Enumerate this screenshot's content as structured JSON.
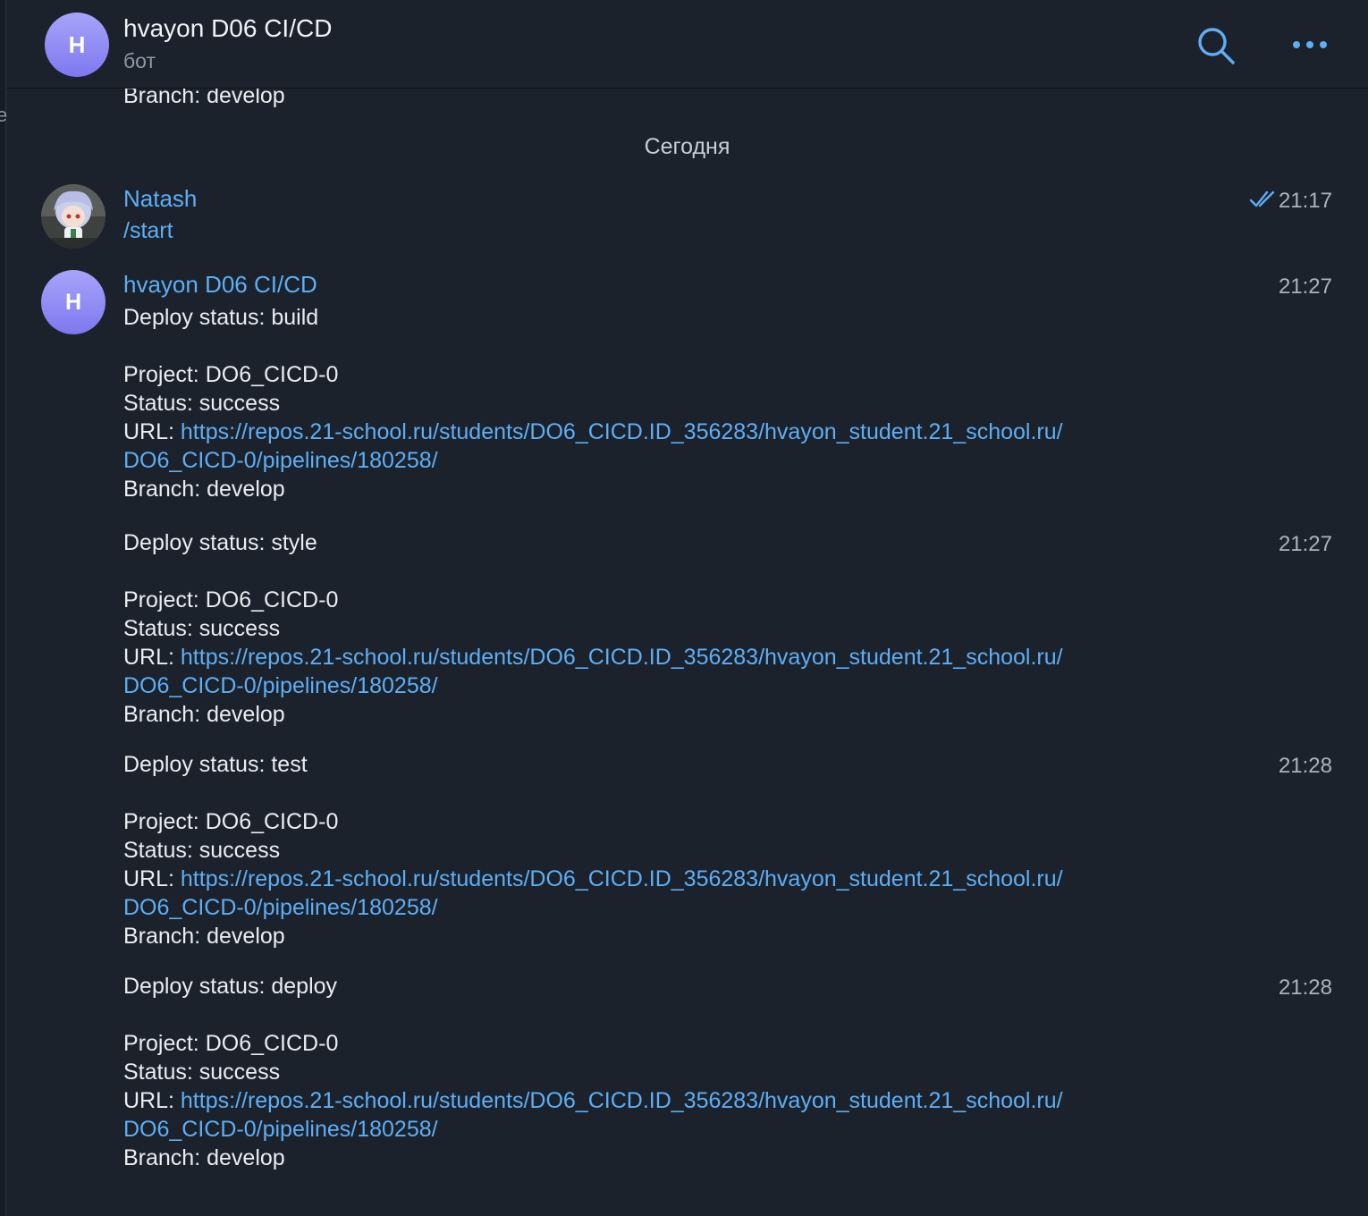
{
  "sidebar_fragment": "e",
  "header": {
    "avatar_letter": "H",
    "title": "hvayon D06 CI/CD",
    "subtitle": "бот",
    "search_icon": "search-icon",
    "more_icon": "more-icon",
    "accent_color": "#5eaef5"
  },
  "chat": {
    "cut_off_line": "Branch: develop",
    "date_separator": "Сегодня",
    "user_message": {
      "sender": "Natash",
      "text": "/start",
      "time": "21:17",
      "status_icon": "double-check-icon"
    },
    "bot_avatar_letter": "H",
    "bot_sender": "hvayon D06 CI/CD",
    "messages": [
      {
        "time": "21:27",
        "status_line": "Deploy status: build",
        "project_line": "Project: DO6_CICD-0",
        "result_line": "Status: success",
        "url_label": "URL: ",
        "url_part1": "https://repos.21-school.ru/students/DO6_CICD.ID_356283/hvayon_student.21_school.ru/",
        "url_part2": "DO6_CICD-0/pipelines/180258/",
        "branch_line": "Branch: develop"
      },
      {
        "time": "21:27",
        "status_line": "Deploy status: style",
        "project_line": "Project: DO6_CICD-0",
        "result_line": "Status: success",
        "url_label": "URL: ",
        "url_part1": "https://repos.21-school.ru/students/DO6_CICD.ID_356283/hvayon_student.21_school.ru/",
        "url_part2": "DO6_CICD-0/pipelines/180258/",
        "branch_line": "Branch: develop"
      },
      {
        "time": "21:28",
        "status_line": "Deploy status: test",
        "project_line": "Project: DO6_CICD-0",
        "result_line": "Status: success",
        "url_label": "URL: ",
        "url_part1": "https://repos.21-school.ru/students/DO6_CICD.ID_356283/hvayon_student.21_school.ru/",
        "url_part2": "DO6_CICD-0/pipelines/180258/",
        "branch_line": "Branch: develop"
      },
      {
        "time": "21:28",
        "status_line": "Deploy status: deploy",
        "project_line": "Project: DO6_CICD-0",
        "result_line": "Status: success",
        "url_label": "URL: ",
        "url_part1": "https://repos.21-school.ru/students/DO6_CICD.ID_356283/hvayon_student.21_school.ru/",
        "url_part2": "DO6_CICD-0/pipelines/180258/",
        "branch_line": "Branch: develop"
      }
    ]
  }
}
